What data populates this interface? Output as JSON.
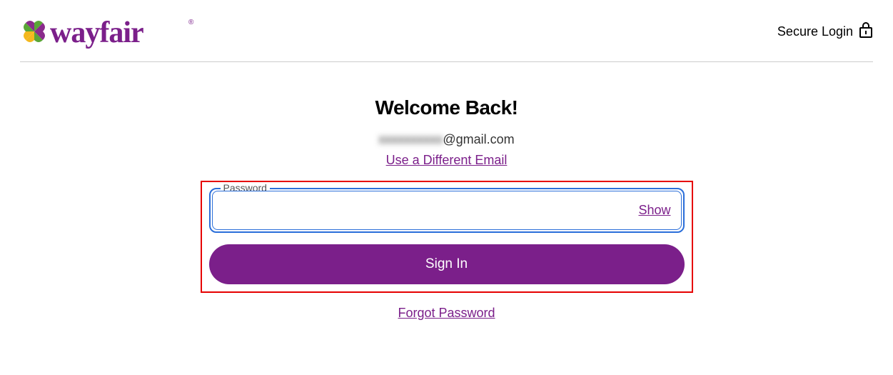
{
  "header": {
    "secure_login_label": "Secure Login"
  },
  "main": {
    "title": "Welcome Back!",
    "email_hidden": "xxxxxxxxxx",
    "email_domain": "@gmail.com",
    "different_email_label": "Use a Different Email",
    "password_label": "Password",
    "password_value": "",
    "show_label": "Show",
    "signin_label": "Sign In",
    "forgot_label": "Forgot Password"
  }
}
